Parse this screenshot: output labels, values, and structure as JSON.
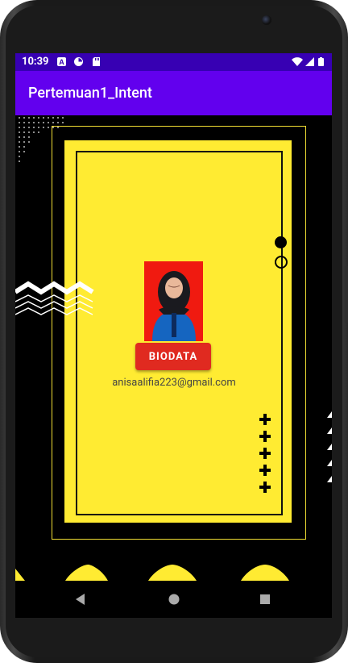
{
  "status_bar": {
    "time": "10:39",
    "left_icons": [
      "a-icon",
      "pie-icon",
      "sd-card-icon"
    ],
    "right_icons": [
      "wifi-icon",
      "signal-icon",
      "battery-icon"
    ]
  },
  "app_bar": {
    "title": "Pertemuan1_Intent"
  },
  "content": {
    "button_label": "BIODATA",
    "email": "anisaalifia223@gmail.com"
  },
  "nav": {
    "buttons": [
      "back-icon",
      "home-icon",
      "recents-icon"
    ]
  },
  "colors": {
    "status_bar": "#3700b3",
    "app_bar": "#6200ee",
    "card_yellow": "#ffeb32",
    "photo_background": "#f01a10",
    "button_red": "#e02a20",
    "background": "#000000"
  }
}
